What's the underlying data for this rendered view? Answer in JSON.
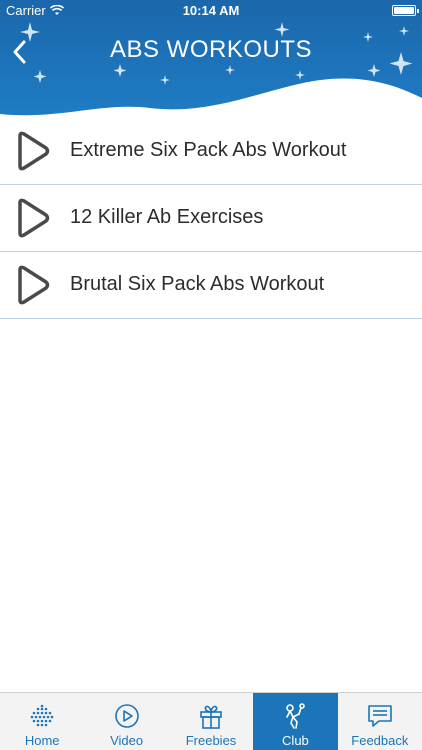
{
  "status": {
    "carrier": "Carrier",
    "time": "10:14 AM"
  },
  "header": {
    "title": "ABS WORKOUTS",
    "back_icon": "chevron-left-icon"
  },
  "videos": [
    {
      "label": "Extreme Six Pack Abs Workout",
      "icon": "play-icon"
    },
    {
      "label": "12 Killer Ab Exercises",
      "icon": "play-icon"
    },
    {
      "label": "Brutal Six Pack Abs Workout",
      "icon": "play-icon"
    }
  ],
  "tabs": [
    {
      "label": "Home",
      "icon": "home-dots-icon",
      "active": false
    },
    {
      "label": "Video",
      "icon": "play-circle-icon",
      "active": false
    },
    {
      "label": "Freebies",
      "icon": "gift-icon",
      "active": false
    },
    {
      "label": "Club",
      "icon": "athlete-icon",
      "active": true
    },
    {
      "label": "Feedback",
      "icon": "chat-bubble-icon",
      "active": false
    }
  ],
  "colors": {
    "header_blue": "#1c6fb4",
    "accent": "#1c75b8",
    "divider": "#b9d3ea",
    "text": "#2c2c2c"
  }
}
